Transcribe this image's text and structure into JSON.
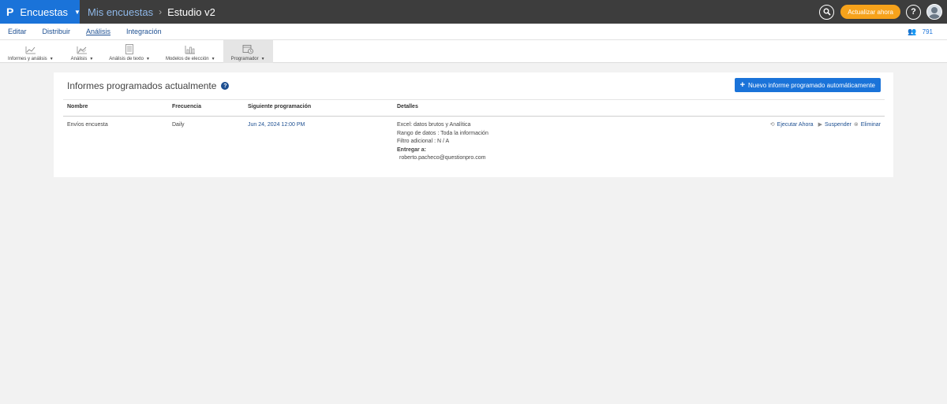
{
  "brand": {
    "logo": "P",
    "product": "Encuestas"
  },
  "breadcrumb": {
    "root": "Mis encuestas",
    "current": "Estudio v2"
  },
  "topbar": {
    "upgrade_label": "Actualizar ahora",
    "help_label": "?"
  },
  "subnav": {
    "tabs": [
      "Editar",
      "Distribuir",
      "Análisis",
      "Integración"
    ],
    "active_tab": "Análisis",
    "user_count": "791"
  },
  "toolbar": {
    "items": [
      {
        "label": "Informes y análisis",
        "icon": "line-chart-icon"
      },
      {
        "label": "Análisis",
        "icon": "area-chart-icon"
      },
      {
        "label": "Análisis de texto",
        "icon": "text-document-icon"
      },
      {
        "label": "Modelos de elección",
        "icon": "bar-chart-icon"
      },
      {
        "label": "Programador",
        "icon": "scheduler-icon"
      }
    ],
    "active_item": "Programador"
  },
  "panel": {
    "title": "Informes programados actualmente",
    "new_button_label": "Nuevo informe programado automáticamente"
  },
  "table": {
    "headers": [
      "Nombre",
      "Frecuencia",
      "Siguiente programación",
      "Detalles"
    ],
    "rows": [
      {
        "name": "Envíos encuesta",
        "frequency": "Daily",
        "next_schedule": "Jun 24, 2024 12:00 PM",
        "details": {
          "line1": "Excel: datos brutos y Analítica",
          "line2": "Rango de datos : Toda la información",
          "line3": "Filtro adicional : N / A",
          "deliver_label": "Entregar a:",
          "email": "roberto.pacheco@questionpro.com"
        },
        "actions": [
          "Ejecutar Ahora",
          "Suspender",
          "Eliminar"
        ]
      }
    ]
  },
  "colors": {
    "brand_blue": "#1a73d9",
    "topbar": "#3d3d3d",
    "upgrade": "#f6a21b",
    "link": "#1d4f91"
  }
}
